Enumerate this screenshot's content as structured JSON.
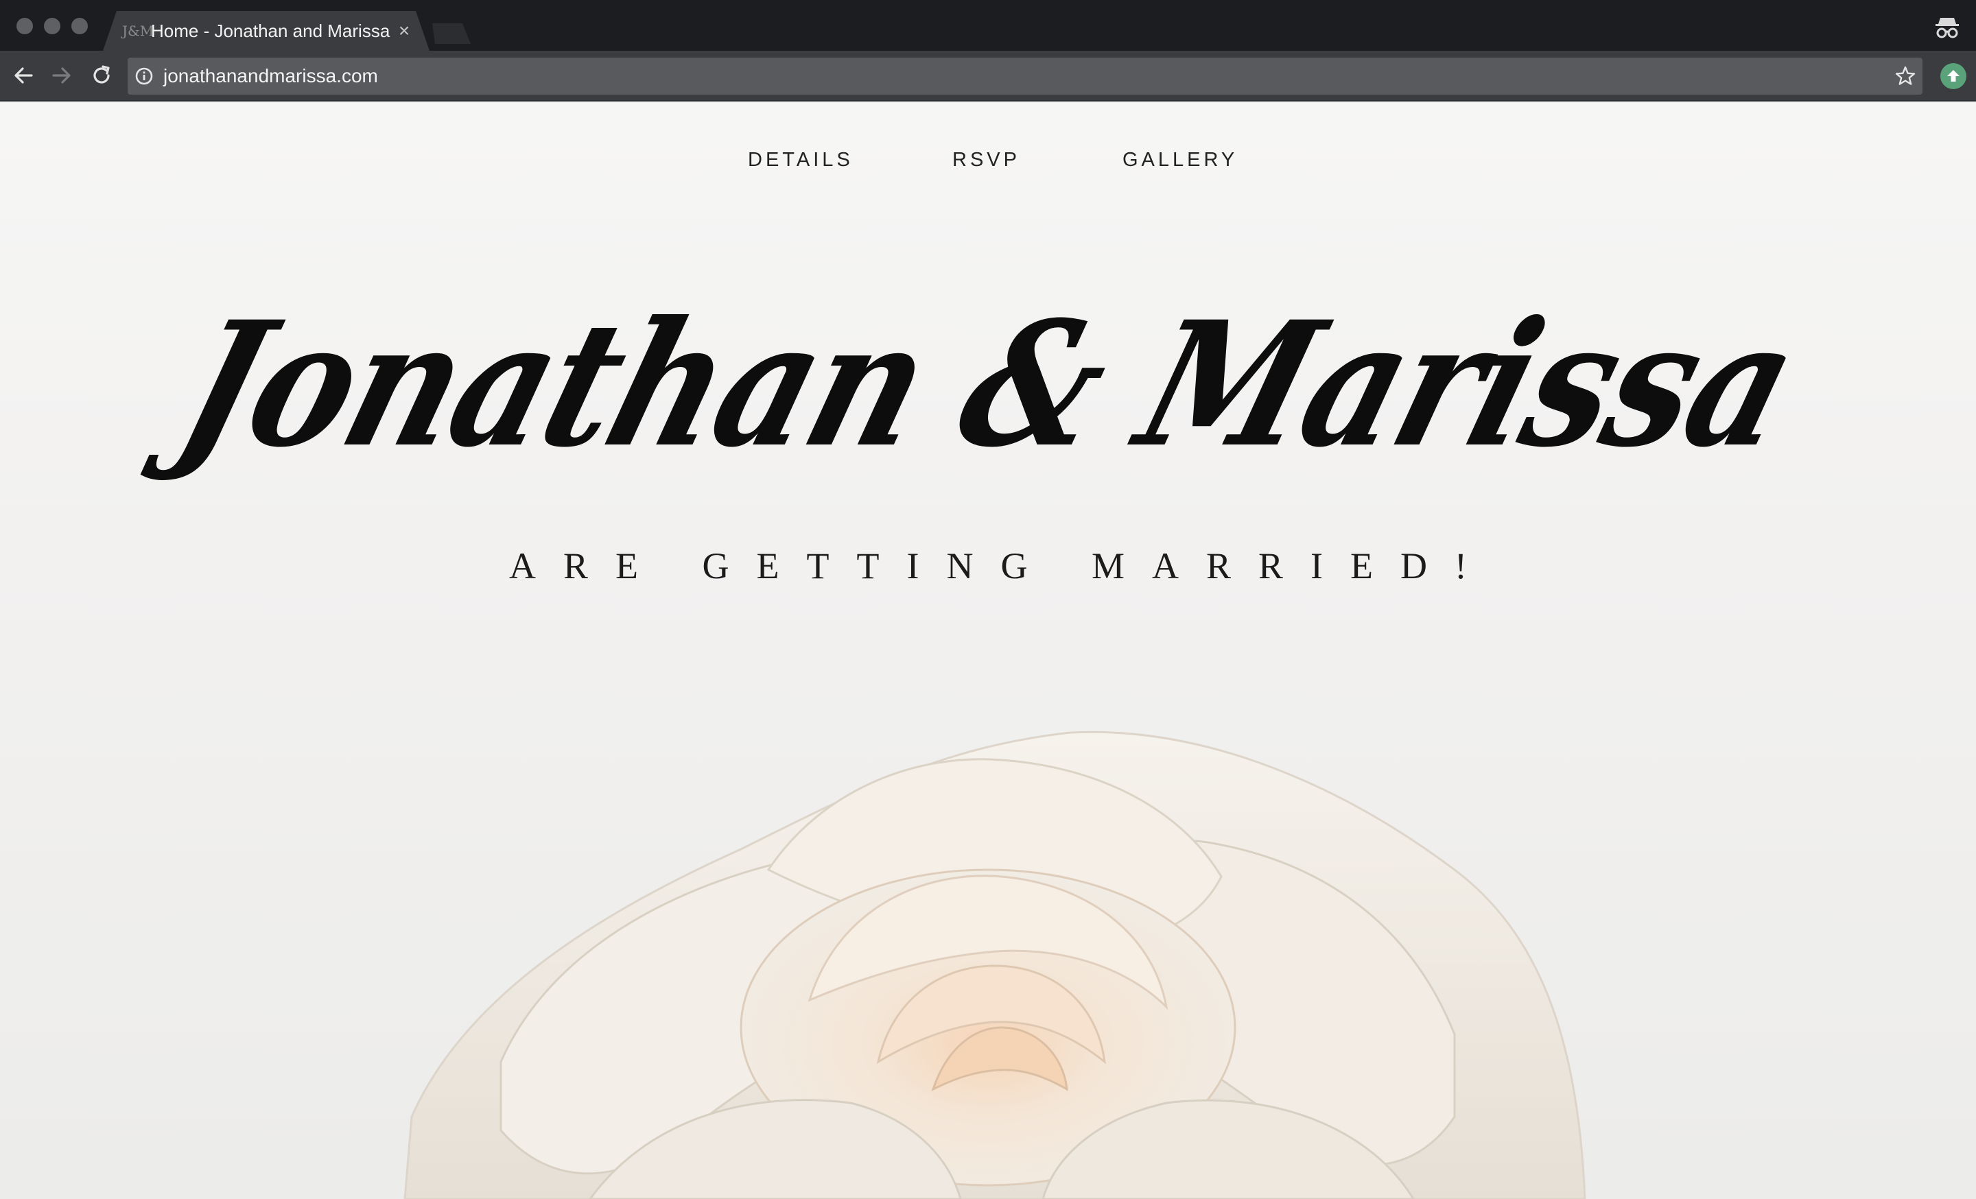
{
  "browser": {
    "tab": {
      "title": "Home - Jonathan and Marissa",
      "close_label": "×",
      "favicon": "J&M"
    },
    "toolbar": {
      "url": "jonathanandmarissa.com"
    },
    "icons": {
      "back": "arrow-left-icon",
      "forward": "arrow-right-icon",
      "reload": "reload-icon",
      "info": "info-icon",
      "bookmark": "star-icon",
      "extension": "upload-arrow-icon",
      "incognito": "incognito-icon"
    }
  },
  "site": {
    "nav": [
      {
        "label": "DETAILS"
      },
      {
        "label": "RSVP"
      },
      {
        "label": "GALLERY"
      }
    ],
    "hero": {
      "title": "Jonathan & Marissa",
      "subtitle": "ARE GETTING MARRIED!"
    }
  },
  "colors": {
    "tabstrip": "#1c1d21",
    "toolbar": "#3b3c40",
    "omnibox": "#595a5e",
    "page_background": "#f3f2f1",
    "text": "#111111",
    "extension_green": "#5aa27a",
    "rose": "#f4ece1"
  }
}
